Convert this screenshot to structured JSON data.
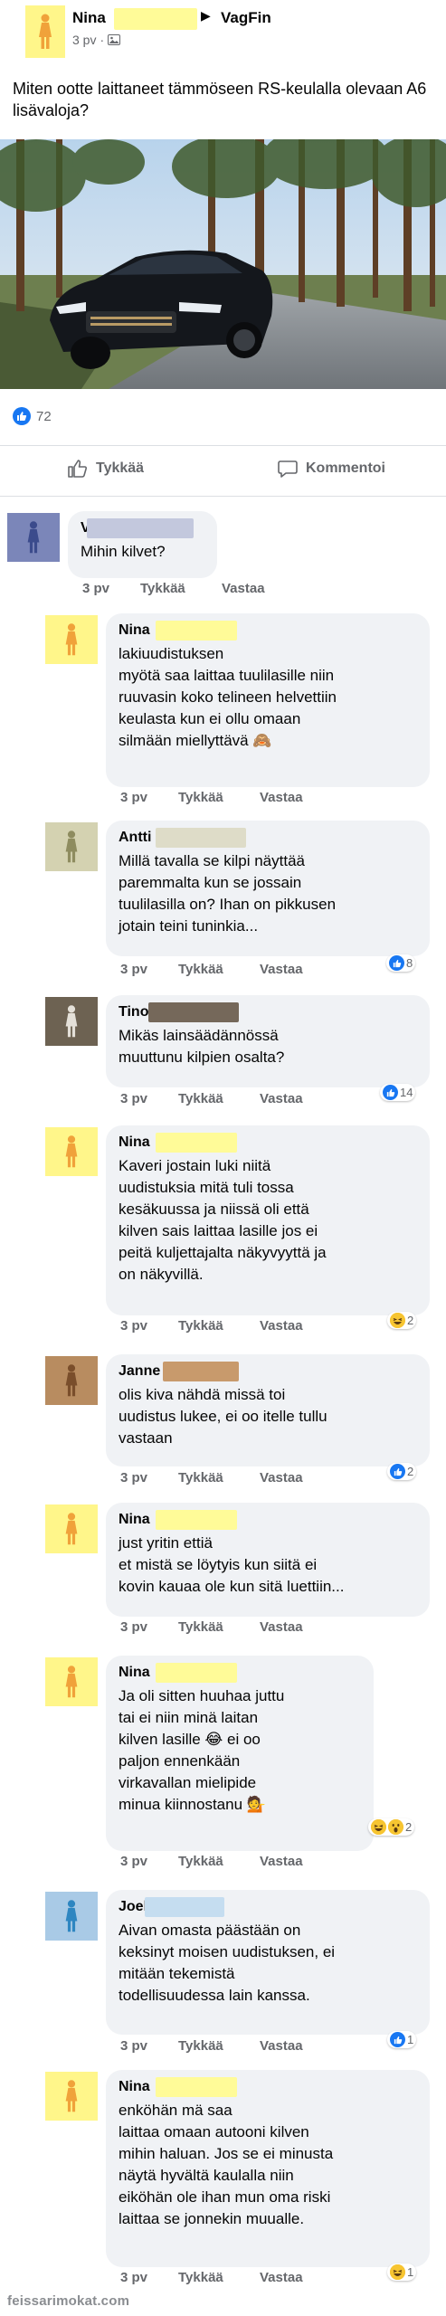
{
  "post": {
    "author": "Nina",
    "group": "VagFin",
    "time": "3 pv",
    "text": "Miten ootte laittaneet tämmöseen RS-keulalla olevaan A6 lisävaloja?",
    "reaction_count": "72",
    "actions": {
      "like": "Tykkää",
      "comment": "Kommentoi"
    }
  },
  "comments": [
    {
      "author": "V",
      "text": "Mihin kilvet?",
      "time": "3 pv",
      "like": "Tykkää",
      "reply": "Vastaa"
    },
    {
      "author": "Nina",
      "text": "lakiuudistuksen\nmyötä saa laittaa tuulilasille niin\nruuvasin koko telineen helvettiin\nkeulasta kun ei ollu omaan\nsilmään miellyttävä 🙈",
      "time": "3 pv",
      "like": "Tykkää",
      "reply": "Vastaa"
    },
    {
      "author": "Antti",
      "text": "Millä tavalla se kilpi näyttää\nparemmalta kun se jossain\ntuulilasilla on? Ihan on pikkusen\njotain teini tuninkia...",
      "time": "3 pv",
      "like": "Tykkää",
      "reply": "Vastaa",
      "reactions": "8"
    },
    {
      "author": "Tino",
      "text": "Mikäs lainsäädännössä\nmuuttunu kilpien osalta?",
      "time": "3 pv",
      "like": "Tykkää",
      "reply": "Vastaa",
      "reactions": "14"
    },
    {
      "author": "Nina",
      "text": "Kaveri jostain luki niitä\nuudistuksia mitä tuli tossa\nkesäkuussa ja niissä oli että\nkilven sais laittaa lasille jos ei\npeitä kuljettajalta näkyvyyttä ja\non näkyvillä.",
      "time": "3 pv",
      "like": "Tykkää",
      "reply": "Vastaa",
      "reactions": "2"
    },
    {
      "author": "Janne",
      "text": "olis kiva nähdä missä toi\nuudistus lukee, ei oo itelle tullu\nvastaan",
      "time": "3 pv",
      "like": "Tykkää",
      "reply": "Vastaa",
      "reactions": "2"
    },
    {
      "author": "Nina",
      "text": "just yritin ettiä\net mistä se löytyis kun siitä ei\nkovin kauaa ole kun sitä luettiin...",
      "time": "3 pv",
      "like": "Tykkää",
      "reply": "Vastaa"
    },
    {
      "author": "Nina",
      "text": "Ja oli sitten huuhaa juttu\ntai ei niin minä laitan\nkilven lasille 😂 ei oo\npaljon ennenkään\nvirkavallan mielipide\nminua kiinnostanu 💁",
      "time": "3 pv",
      "like": "Tykkää",
      "reply": "Vastaa",
      "reactions": "2"
    },
    {
      "author": "Joel",
      "text": "Aivan omasta päästään on\nkeksinyt moisen uudistuksen, ei\nmitään tekemistä\ntodellisuudessa lain kanssa.",
      "time": "3 pv",
      "like": "Tykkää",
      "reply": "Vastaa",
      "reactions": "1"
    },
    {
      "author": "Nina",
      "text": "enköhän mä saa\nlaittaa omaan autooni kilven\nmihin haluan. Jos se ei minusta\nnäytä hyvältä kaulalla niin\neiköhän ole ihan mun oma riski\nlaittaa se jonnekin muualle.",
      "time": "3 pv",
      "like": "Tykkää",
      "reply": "Vastaa",
      "reactions": "1"
    }
  ],
  "watermark": "feissarimokat.com",
  "colors": {
    "avatar_yellow": "#fff68a",
    "avatar_orange": "#f0a23a",
    "redact_yellow": "#fffb98",
    "facebook_blue": "#1877f2",
    "bubble_gray": "#f0f2f5"
  }
}
